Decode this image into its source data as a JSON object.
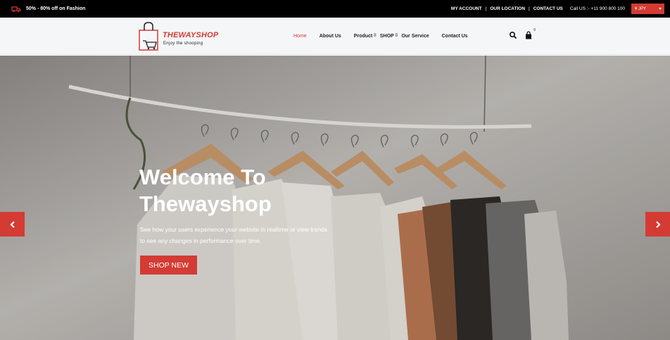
{
  "topbar": {
    "promo_text": "50% - 80% off on Fashion",
    "promo_icon": "truck-icon",
    "links": {
      "account": "MY ACCOUNT",
      "location": "OUR LOCATION",
      "contact": "CONTACT US"
    },
    "separator": "|",
    "call": "Call US :- +11 900 800 100",
    "currency": "¥ JPY"
  },
  "header": {
    "logo_title": "THEWAYSHOP",
    "logo_subtitle": "Enjoy the shooping",
    "nav": {
      "home": "Home",
      "about": "About Us",
      "product": "Product",
      "shop": "SHOP",
      "service": "Our Service",
      "contact": "Contact Us"
    },
    "dropdown_glyph": "⌷",
    "cart_count": "0"
  },
  "hero": {
    "title_line1": "Welcome To",
    "title_line2": "Thewayshop",
    "text": "See how your users experience your website in realtime or view trends to see any changes in performance over time.",
    "button": "SHOP NEW"
  },
  "colors": {
    "accent": "#d33b33",
    "topbar_bg": "#000000",
    "header_bg": "#f5f6f8"
  }
}
